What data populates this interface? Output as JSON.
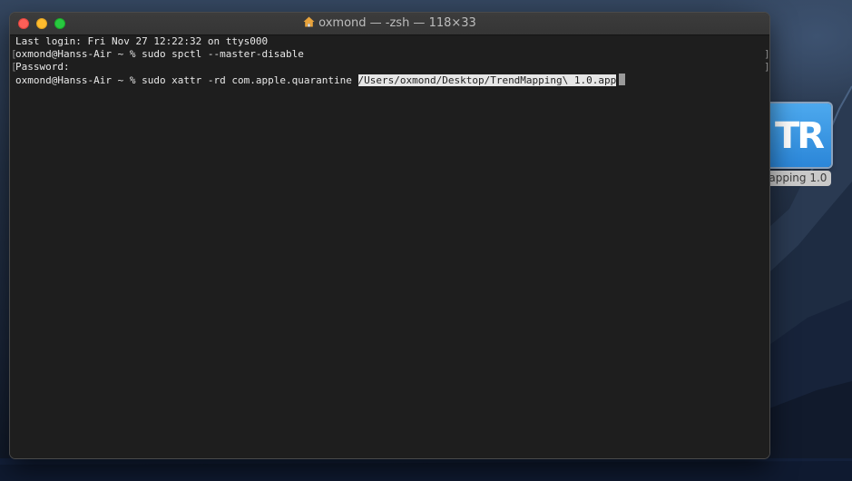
{
  "window": {
    "title": "oxmond — -zsh — 118×33"
  },
  "terminal": {
    "lines": [
      "Last login: Fri Nov 27 12:22:32 on ttys000",
      "oxmond@Hanss-Air ~ % sudo spctl --master-disable",
      "Password:",
      "oxmond@Hanss-Air ~ % sudo xattr -rd com.apple.quarantine "
    ],
    "selected_path": "/Users/oxmond/Desktop/TrendMapping\\ 1.0.app",
    "marks": {
      "left": "[",
      "right": "]"
    }
  },
  "desktop": {
    "icon_glyph": "TR",
    "icon_label": "Mapping 1.0"
  },
  "colors": {
    "terminal_bg": "#1e1e1e",
    "terminal_text": "#e8e8e8",
    "close": "#fe5f57",
    "minimize": "#febc2e",
    "maximize": "#28c840",
    "app_icon": "#2b86d8"
  },
  "icons": {
    "title_icon": "home-icon"
  }
}
